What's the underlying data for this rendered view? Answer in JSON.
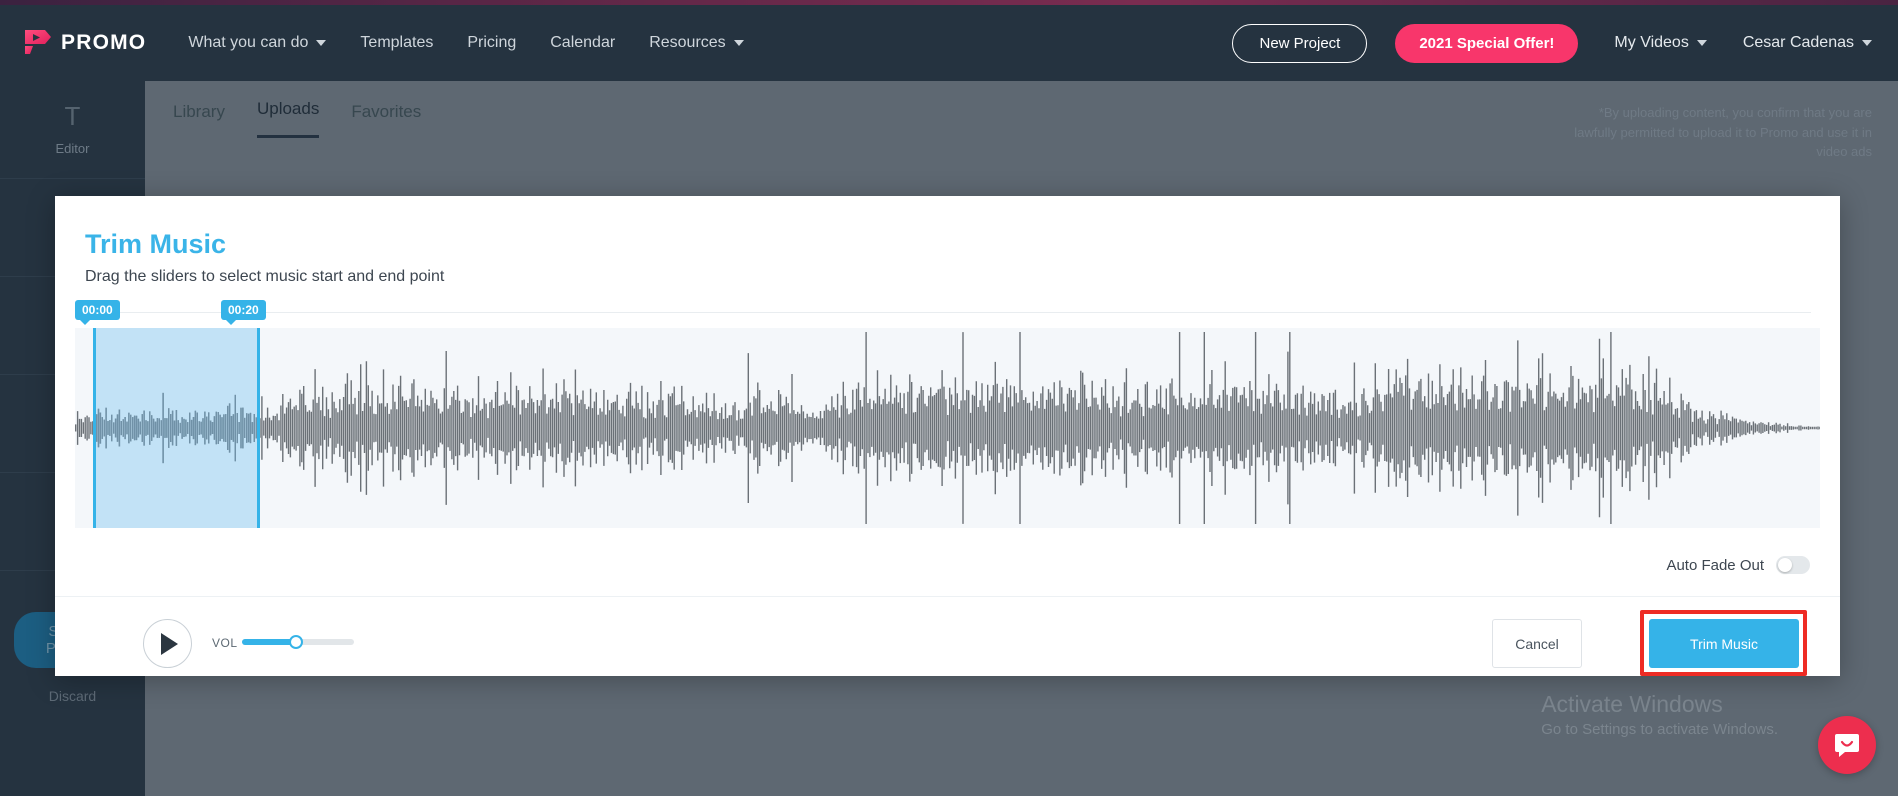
{
  "brand": {
    "name": "PROMO",
    "logo_icon": "promo-play-logo",
    "accent": "#f8366b"
  },
  "header": {
    "nav": [
      {
        "label": "What you can do",
        "has_caret": true
      },
      {
        "label": "Templates",
        "has_caret": false
      },
      {
        "label": "Pricing",
        "has_caret": false
      },
      {
        "label": "Calendar",
        "has_caret": false
      },
      {
        "label": "Resources",
        "has_caret": true
      }
    ],
    "new_project_label": "New Project",
    "special_offer_label": "2021 Special Offer!",
    "my_videos_label": "My Videos",
    "account_label": "Cesar Cadenas",
    "background": "#253340"
  },
  "sidebar": {
    "items": [
      {
        "label": "Editor",
        "icon": "text-tool-icon"
      }
    ],
    "save_label": "Save & Preview",
    "discard_label": "Discard"
  },
  "content": {
    "tabs": [
      {
        "label": "Library",
        "active": false
      },
      {
        "label": "Uploads",
        "active": true
      },
      {
        "label": "Favorites",
        "active": false
      }
    ],
    "disclaimer": "*By uploading content, you confirm that you are lawfully permitted to upload it to Promo and use it in video ads"
  },
  "modal": {
    "title": "Trim Music",
    "title_color": "#3ab4e8",
    "subtitle": "Drag the sliders to select music start and end point",
    "trim": {
      "start_time": "00:00",
      "end_time": "00:20",
      "selection_color": "#35b3e8"
    },
    "auto_fade_label": "Auto Fade Out",
    "auto_fade_on": false,
    "play_icon": "play-icon",
    "volume_label": "VOL",
    "volume_percent": 47,
    "cancel_label": "Cancel",
    "trim_label": "Trim Music"
  },
  "watermark": {
    "title": "Activate Windows",
    "subtitle": "Go to Settings to activate Windows."
  },
  "chat": {
    "icon": "intercom-chat-icon",
    "color": "#ed2e4e"
  }
}
